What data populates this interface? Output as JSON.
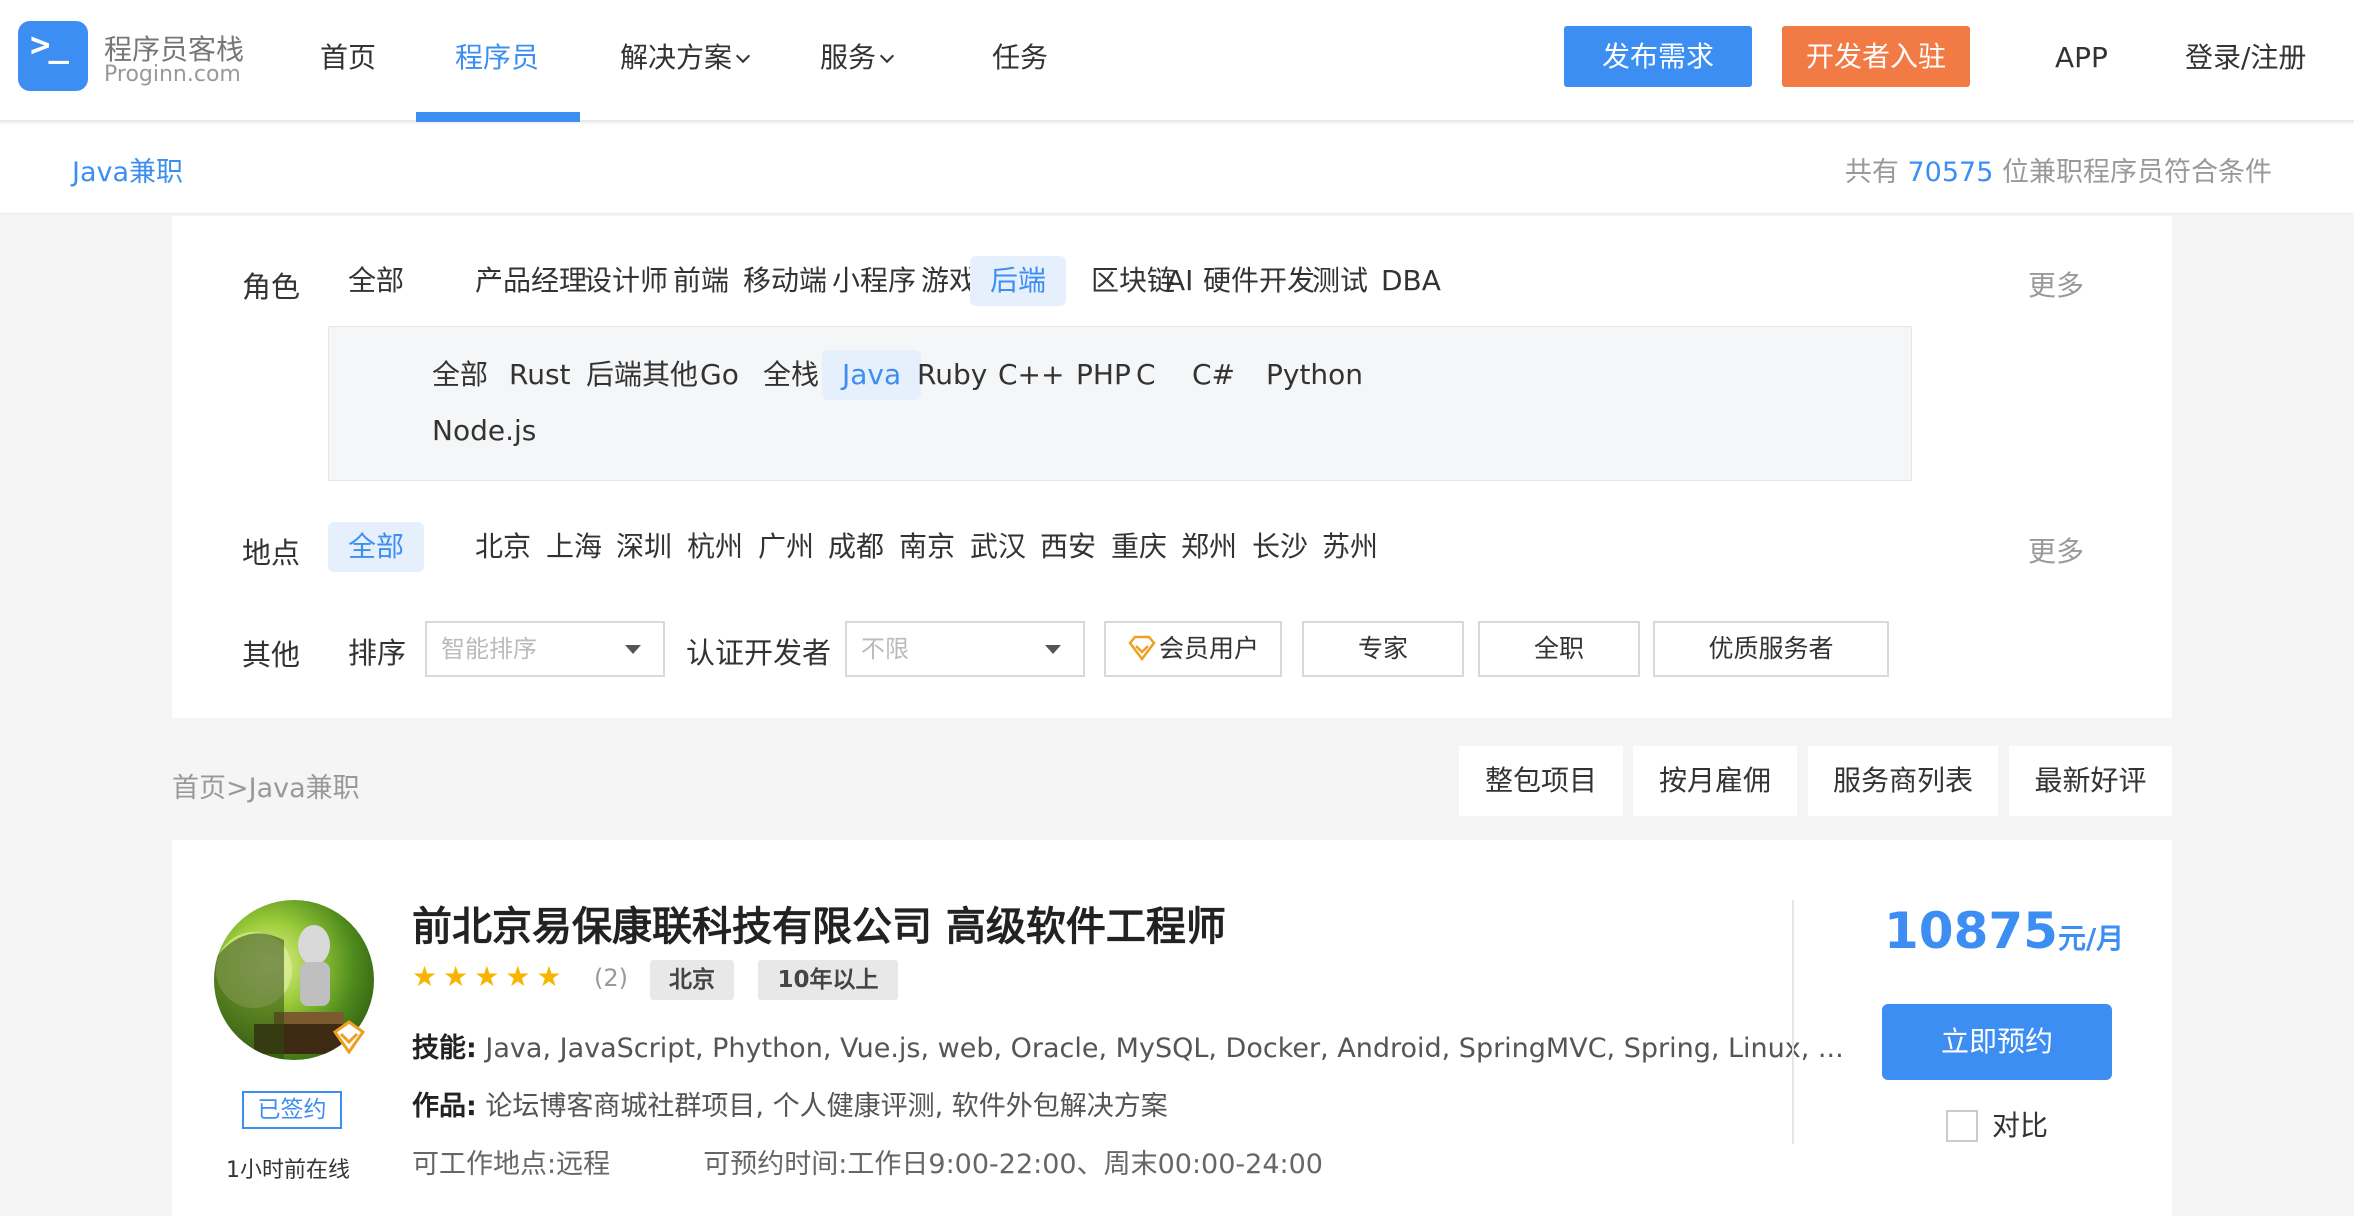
{
  "header": {
    "logo_mark": ">_",
    "logo_cn": "程序员客栈",
    "logo_en": "Proginn.com",
    "nav": [
      {
        "label": "首页"
      },
      {
        "label": "程序员"
      },
      {
        "label": "解决方案"
      },
      {
        "label": "服务"
      },
      {
        "label": "任务"
      }
    ],
    "publish_label": "发布需求",
    "developer_label": "开发者入驻",
    "app_label": "APP",
    "login_label": "登录/注册",
    "accent_color": "#3d8ef2",
    "orange_color": "#f17a45"
  },
  "subheader": {
    "title": "Java兼职",
    "count_prefix": "共有",
    "count": "70575",
    "count_suffix": "位兼职程序员符合条件"
  },
  "filters": {
    "role_label": "角色",
    "roles": [
      "全部",
      "产品经理",
      "设计师",
      "前端",
      "移动端",
      "小程序",
      "游戏",
      "后端",
      "区块链",
      "AI",
      "硬件开发",
      "测试",
      "DBA"
    ],
    "role_selected": "后端",
    "more_label": "更多",
    "sub_roles": [
      "全部",
      "Rust",
      "后端其他",
      "Go",
      "全栈",
      "Java",
      "Ruby",
      "C++",
      "PHP",
      "C",
      "C#",
      "Python",
      "Node.js"
    ],
    "sub_role_selected": "Java",
    "location_label": "地点",
    "locations": [
      "全部",
      "北京",
      "上海",
      "深圳",
      "杭州",
      "广州",
      "成都",
      "南京",
      "武汉",
      "西安",
      "重庆",
      "郑州",
      "长沙",
      "苏州"
    ],
    "location_selected": "全部",
    "other_label": "其他",
    "sort_label": "排序",
    "sort_value": "智能排序",
    "cert_label": "认证开发者",
    "cert_value": "不限",
    "tags": [
      "会员用户",
      "专家",
      "全职",
      "优质服务者"
    ]
  },
  "breadcrumb": {
    "home": "首页",
    "sep": ">",
    "current": "Java兼职",
    "tabs": [
      "整包项目",
      "按月雇佣",
      "服务商列表",
      "最新好评"
    ]
  },
  "cards": [
    {
      "title": "前北京易保康联科技有限公司 高级软件工程师",
      "stars": "★★★★★",
      "rating_count": "(2)",
      "city": "北京",
      "experience": "10年以上",
      "skills_label": "技能:",
      "skills": "Java, JavaScript, Phython, Vue.js, web, Oracle, MySQL, Docker, Android, SpringMVC, Spring, Linux, ...",
      "works_label": "作品:",
      "works": "论坛博客商城社群项目, 个人健康评测, 软件外包解决方案",
      "location_label": "可工作地点:",
      "location": "远程",
      "time_label": "可预约时间:",
      "time": "工作日9:00-22:00、周末00:00-24:00",
      "signed_label": "已签约",
      "online": "1小时前在线",
      "price": "10875",
      "price_unit": "元/月",
      "book_label": "立即预约",
      "compare_label": "对比"
    }
  ]
}
